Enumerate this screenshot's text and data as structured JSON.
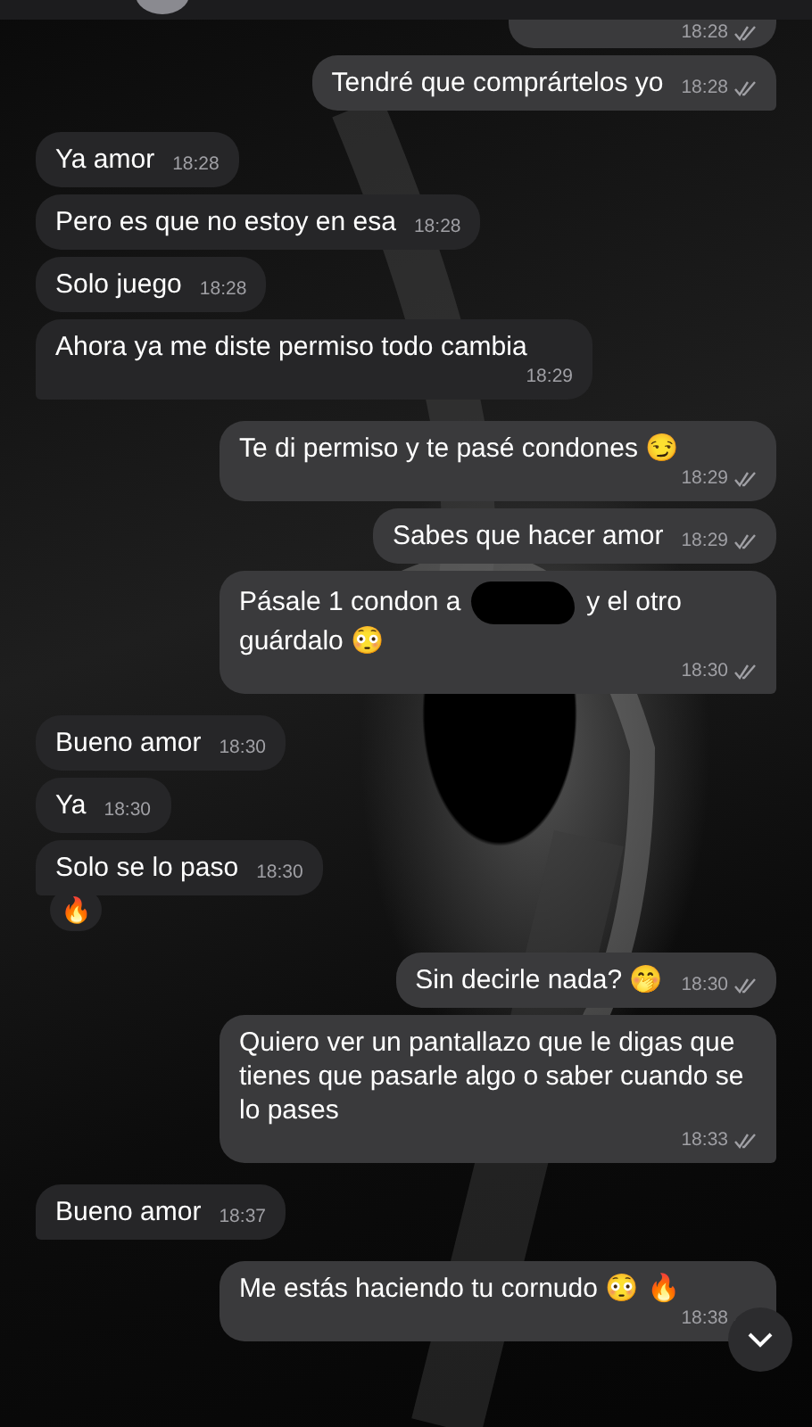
{
  "messages": [
    {
      "outgoing": true,
      "tail": false,
      "kind": "cut",
      "time": "18:28"
    },
    {
      "outgoing": true,
      "tail": true,
      "kind": "text",
      "text": "Tendré que comprártelos yo",
      "time": "18:28"
    },
    {
      "outgoing": false,
      "tail": false,
      "kind": "text",
      "text": "Ya amor",
      "time": "18:28"
    },
    {
      "outgoing": false,
      "tail": false,
      "kind": "text",
      "text": "Pero es que no estoy en esa",
      "time": "18:28"
    },
    {
      "outgoing": false,
      "tail": false,
      "kind": "text",
      "text": "Solo juego",
      "time": "18:28"
    },
    {
      "outgoing": false,
      "tail": true,
      "kind": "text",
      "text": "Ahora ya me diste permiso todo cambia",
      "time": "18:29"
    },
    {
      "outgoing": true,
      "tail": false,
      "kind": "text",
      "text": "Te di permiso y te pasé condones 😏",
      "time": "18:29"
    },
    {
      "outgoing": true,
      "tail": false,
      "kind": "text",
      "text": "Sabes que hacer amor",
      "time": "18:29"
    },
    {
      "outgoing": true,
      "tail": true,
      "kind": "redacted",
      "text": "Pásale 1 condon a",
      "text_after": "y el otro guárdalo 😳",
      "time": "18:30"
    },
    {
      "outgoing": false,
      "tail": false,
      "kind": "text",
      "text": "Bueno amor",
      "time": "18:30"
    },
    {
      "outgoing": false,
      "tail": false,
      "kind": "text",
      "text": "Ya",
      "time": "18:30"
    },
    {
      "outgoing": false,
      "tail": true,
      "kind": "text",
      "text": "Solo se lo paso",
      "time": "18:30",
      "reaction": "🔥"
    },
    {
      "outgoing": true,
      "tail": false,
      "kind": "text",
      "text": "Sin decirle nada? 🤭",
      "time": "18:30"
    },
    {
      "outgoing": true,
      "tail": true,
      "kind": "text",
      "text": "Quiero ver un pantallazo que le digas que tienes que pasarle algo o saber cuando se lo pases",
      "time": "18:33"
    },
    {
      "outgoing": false,
      "tail": true,
      "kind": "text",
      "text": "Bueno amor",
      "time": "18:37"
    },
    {
      "outgoing": true,
      "tail": true,
      "kind": "text",
      "text": "Me estás haciendo tu cornudo 😳 🔥",
      "time": "18:38"
    }
  ]
}
